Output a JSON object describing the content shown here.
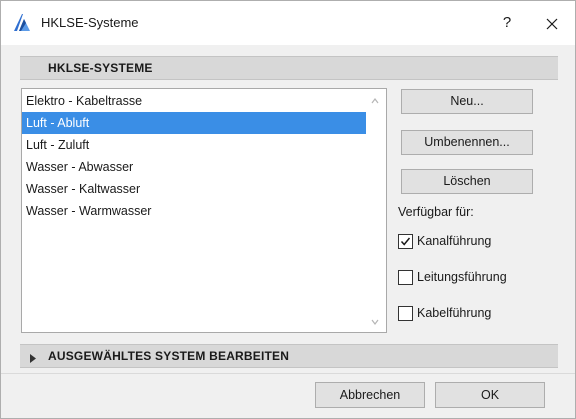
{
  "window": {
    "title": "HKLSE-Systeme",
    "help_label": "?",
    "icons": {
      "app": "archicad-logo-icon",
      "close": "close-icon"
    }
  },
  "section": {
    "title": "HKLSE-SYSTEME"
  },
  "systems": {
    "items": [
      "Elektro - Kabeltrasse",
      "Luft - Abluft",
      "Luft - Zuluft",
      "Wasser - Abwasser",
      "Wasser - Kaltwasser",
      "Wasser - Warmwasser"
    ],
    "selected": "Luft - Abluft"
  },
  "actions": {
    "new_label": "Neu...",
    "rename_label": "Umbenennen...",
    "delete_label": "Löschen"
  },
  "availability": {
    "label": "Verfügbar für:",
    "options": [
      {
        "label": "Kanalführung",
        "checked": true
      },
      {
        "label": "Leitungsführung",
        "checked": false
      },
      {
        "label": "Kabelführung",
        "checked": false
      }
    ]
  },
  "edit_section": {
    "title": "AUSGEWÄHLTES SYSTEM BEARBEITEN",
    "expanded": false
  },
  "footer": {
    "cancel_label": "Abbrechen",
    "ok_label": "OK"
  },
  "colors": {
    "selection": "#3a8ee6",
    "header_band": "#d8d8d8",
    "dialog_bg": "#f0f0f0"
  }
}
